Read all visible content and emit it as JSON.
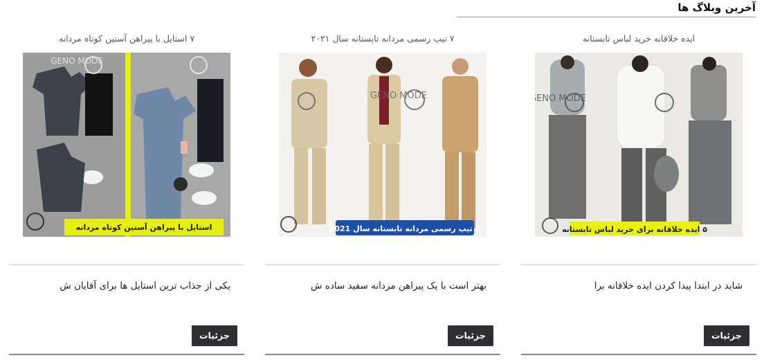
{
  "section": {
    "title": "آخرین وبلاگ ها"
  },
  "posts": [
    {
      "title": "ایده خلاقانه خرید لباس تابستانه",
      "excerpt": "شاید در ابتدا پیدا کردن ایده خلاقانه برا",
      "details_label": "جزئیات",
      "image": {
        "brand": "GENO MODE",
        "banner_text": "۵ ایده خلاقانه برای خرید لباس تابستانه",
        "banner_color": "#e9f10a"
      }
    },
    {
      "title": "۷ تیپ رسمی مردانه تابستانه سال ۲۰۲۱",
      "excerpt": "بهتر است با یک پیراهن مردانه سفید ساده ش",
      "details_label": "جزئیات",
      "image": {
        "brand": "GENO MODE",
        "banner_text": "7 تیپ رسمی مردانه تابستانه سال 2021",
        "banner_color": "#1d4fa8"
      }
    },
    {
      "title": "۷ استایل با پیراهن آستین کوتاه مردانه",
      "excerpt": "یکی از جذاب ترین استایل ها برای آقایان ش",
      "details_label": "جزئیات",
      "image": {
        "brand": "GENO MODE",
        "banner_text": "استایل با پیراهن آستین کوتاه مردانه",
        "banner_color": "#e6ee12"
      }
    }
  ],
  "colors": {
    "button_bg": "#2f2f33",
    "divider": "#8c8c8c"
  }
}
